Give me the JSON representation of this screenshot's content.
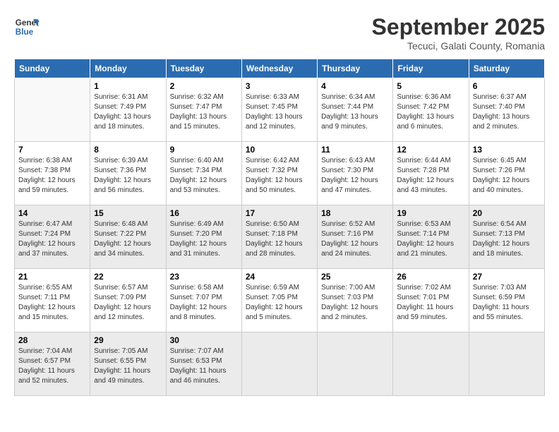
{
  "header": {
    "logo_line1": "General",
    "logo_line2": "Blue",
    "month": "September 2025",
    "location": "Tecuci, Galati County, Romania"
  },
  "days_of_week": [
    "Sunday",
    "Monday",
    "Tuesday",
    "Wednesday",
    "Thursday",
    "Friday",
    "Saturday"
  ],
  "weeks": [
    [
      {
        "day": "",
        "sunrise": "",
        "sunset": "",
        "daylight": ""
      },
      {
        "day": "1",
        "sunrise": "Sunrise: 6:31 AM",
        "sunset": "Sunset: 7:49 PM",
        "daylight": "Daylight: 13 hours and 18 minutes."
      },
      {
        "day": "2",
        "sunrise": "Sunrise: 6:32 AM",
        "sunset": "Sunset: 7:47 PM",
        "daylight": "Daylight: 13 hours and 15 minutes."
      },
      {
        "day": "3",
        "sunrise": "Sunrise: 6:33 AM",
        "sunset": "Sunset: 7:45 PM",
        "daylight": "Daylight: 13 hours and 12 minutes."
      },
      {
        "day": "4",
        "sunrise": "Sunrise: 6:34 AM",
        "sunset": "Sunset: 7:44 PM",
        "daylight": "Daylight: 13 hours and 9 minutes."
      },
      {
        "day": "5",
        "sunrise": "Sunrise: 6:36 AM",
        "sunset": "Sunset: 7:42 PM",
        "daylight": "Daylight: 13 hours and 6 minutes."
      },
      {
        "day": "6",
        "sunrise": "Sunrise: 6:37 AM",
        "sunset": "Sunset: 7:40 PM",
        "daylight": "Daylight: 13 hours and 2 minutes."
      }
    ],
    [
      {
        "day": "7",
        "sunrise": "Sunrise: 6:38 AM",
        "sunset": "Sunset: 7:38 PM",
        "daylight": "Daylight: 12 hours and 59 minutes."
      },
      {
        "day": "8",
        "sunrise": "Sunrise: 6:39 AM",
        "sunset": "Sunset: 7:36 PM",
        "daylight": "Daylight: 12 hours and 56 minutes."
      },
      {
        "day": "9",
        "sunrise": "Sunrise: 6:40 AM",
        "sunset": "Sunset: 7:34 PM",
        "daylight": "Daylight: 12 hours and 53 minutes."
      },
      {
        "day": "10",
        "sunrise": "Sunrise: 6:42 AM",
        "sunset": "Sunset: 7:32 PM",
        "daylight": "Daylight: 12 hours and 50 minutes."
      },
      {
        "day": "11",
        "sunrise": "Sunrise: 6:43 AM",
        "sunset": "Sunset: 7:30 PM",
        "daylight": "Daylight: 12 hours and 47 minutes."
      },
      {
        "day": "12",
        "sunrise": "Sunrise: 6:44 AM",
        "sunset": "Sunset: 7:28 PM",
        "daylight": "Daylight: 12 hours and 43 minutes."
      },
      {
        "day": "13",
        "sunrise": "Sunrise: 6:45 AM",
        "sunset": "Sunset: 7:26 PM",
        "daylight": "Daylight: 12 hours and 40 minutes."
      }
    ],
    [
      {
        "day": "14",
        "sunrise": "Sunrise: 6:47 AM",
        "sunset": "Sunset: 7:24 PM",
        "daylight": "Daylight: 12 hours and 37 minutes."
      },
      {
        "day": "15",
        "sunrise": "Sunrise: 6:48 AM",
        "sunset": "Sunset: 7:22 PM",
        "daylight": "Daylight: 12 hours and 34 minutes."
      },
      {
        "day": "16",
        "sunrise": "Sunrise: 6:49 AM",
        "sunset": "Sunset: 7:20 PM",
        "daylight": "Daylight: 12 hours and 31 minutes."
      },
      {
        "day": "17",
        "sunrise": "Sunrise: 6:50 AM",
        "sunset": "Sunset: 7:18 PM",
        "daylight": "Daylight: 12 hours and 28 minutes."
      },
      {
        "day": "18",
        "sunrise": "Sunrise: 6:52 AM",
        "sunset": "Sunset: 7:16 PM",
        "daylight": "Daylight: 12 hours and 24 minutes."
      },
      {
        "day": "19",
        "sunrise": "Sunrise: 6:53 AM",
        "sunset": "Sunset: 7:14 PM",
        "daylight": "Daylight: 12 hours and 21 minutes."
      },
      {
        "day": "20",
        "sunrise": "Sunrise: 6:54 AM",
        "sunset": "Sunset: 7:13 PM",
        "daylight": "Daylight: 12 hours and 18 minutes."
      }
    ],
    [
      {
        "day": "21",
        "sunrise": "Sunrise: 6:55 AM",
        "sunset": "Sunset: 7:11 PM",
        "daylight": "Daylight: 12 hours and 15 minutes."
      },
      {
        "day": "22",
        "sunrise": "Sunrise: 6:57 AM",
        "sunset": "Sunset: 7:09 PM",
        "daylight": "Daylight: 12 hours and 12 minutes."
      },
      {
        "day": "23",
        "sunrise": "Sunrise: 6:58 AM",
        "sunset": "Sunset: 7:07 PM",
        "daylight": "Daylight: 12 hours and 8 minutes."
      },
      {
        "day": "24",
        "sunrise": "Sunrise: 6:59 AM",
        "sunset": "Sunset: 7:05 PM",
        "daylight": "Daylight: 12 hours and 5 minutes."
      },
      {
        "day": "25",
        "sunrise": "Sunrise: 7:00 AM",
        "sunset": "Sunset: 7:03 PM",
        "daylight": "Daylight: 12 hours and 2 minutes."
      },
      {
        "day": "26",
        "sunrise": "Sunrise: 7:02 AM",
        "sunset": "Sunset: 7:01 PM",
        "daylight": "Daylight: 11 hours and 59 minutes."
      },
      {
        "day": "27",
        "sunrise": "Sunrise: 7:03 AM",
        "sunset": "Sunset: 6:59 PM",
        "daylight": "Daylight: 11 hours and 55 minutes."
      }
    ],
    [
      {
        "day": "28",
        "sunrise": "Sunrise: 7:04 AM",
        "sunset": "Sunset: 6:57 PM",
        "daylight": "Daylight: 11 hours and 52 minutes."
      },
      {
        "day": "29",
        "sunrise": "Sunrise: 7:05 AM",
        "sunset": "Sunset: 6:55 PM",
        "daylight": "Daylight: 11 hours and 49 minutes."
      },
      {
        "day": "30",
        "sunrise": "Sunrise: 7:07 AM",
        "sunset": "Sunset: 6:53 PM",
        "daylight": "Daylight: 11 hours and 46 minutes."
      },
      {
        "day": "",
        "sunrise": "",
        "sunset": "",
        "daylight": ""
      },
      {
        "day": "",
        "sunrise": "",
        "sunset": "",
        "daylight": ""
      },
      {
        "day": "",
        "sunrise": "",
        "sunset": "",
        "daylight": ""
      },
      {
        "day": "",
        "sunrise": "",
        "sunset": "",
        "daylight": ""
      }
    ]
  ]
}
